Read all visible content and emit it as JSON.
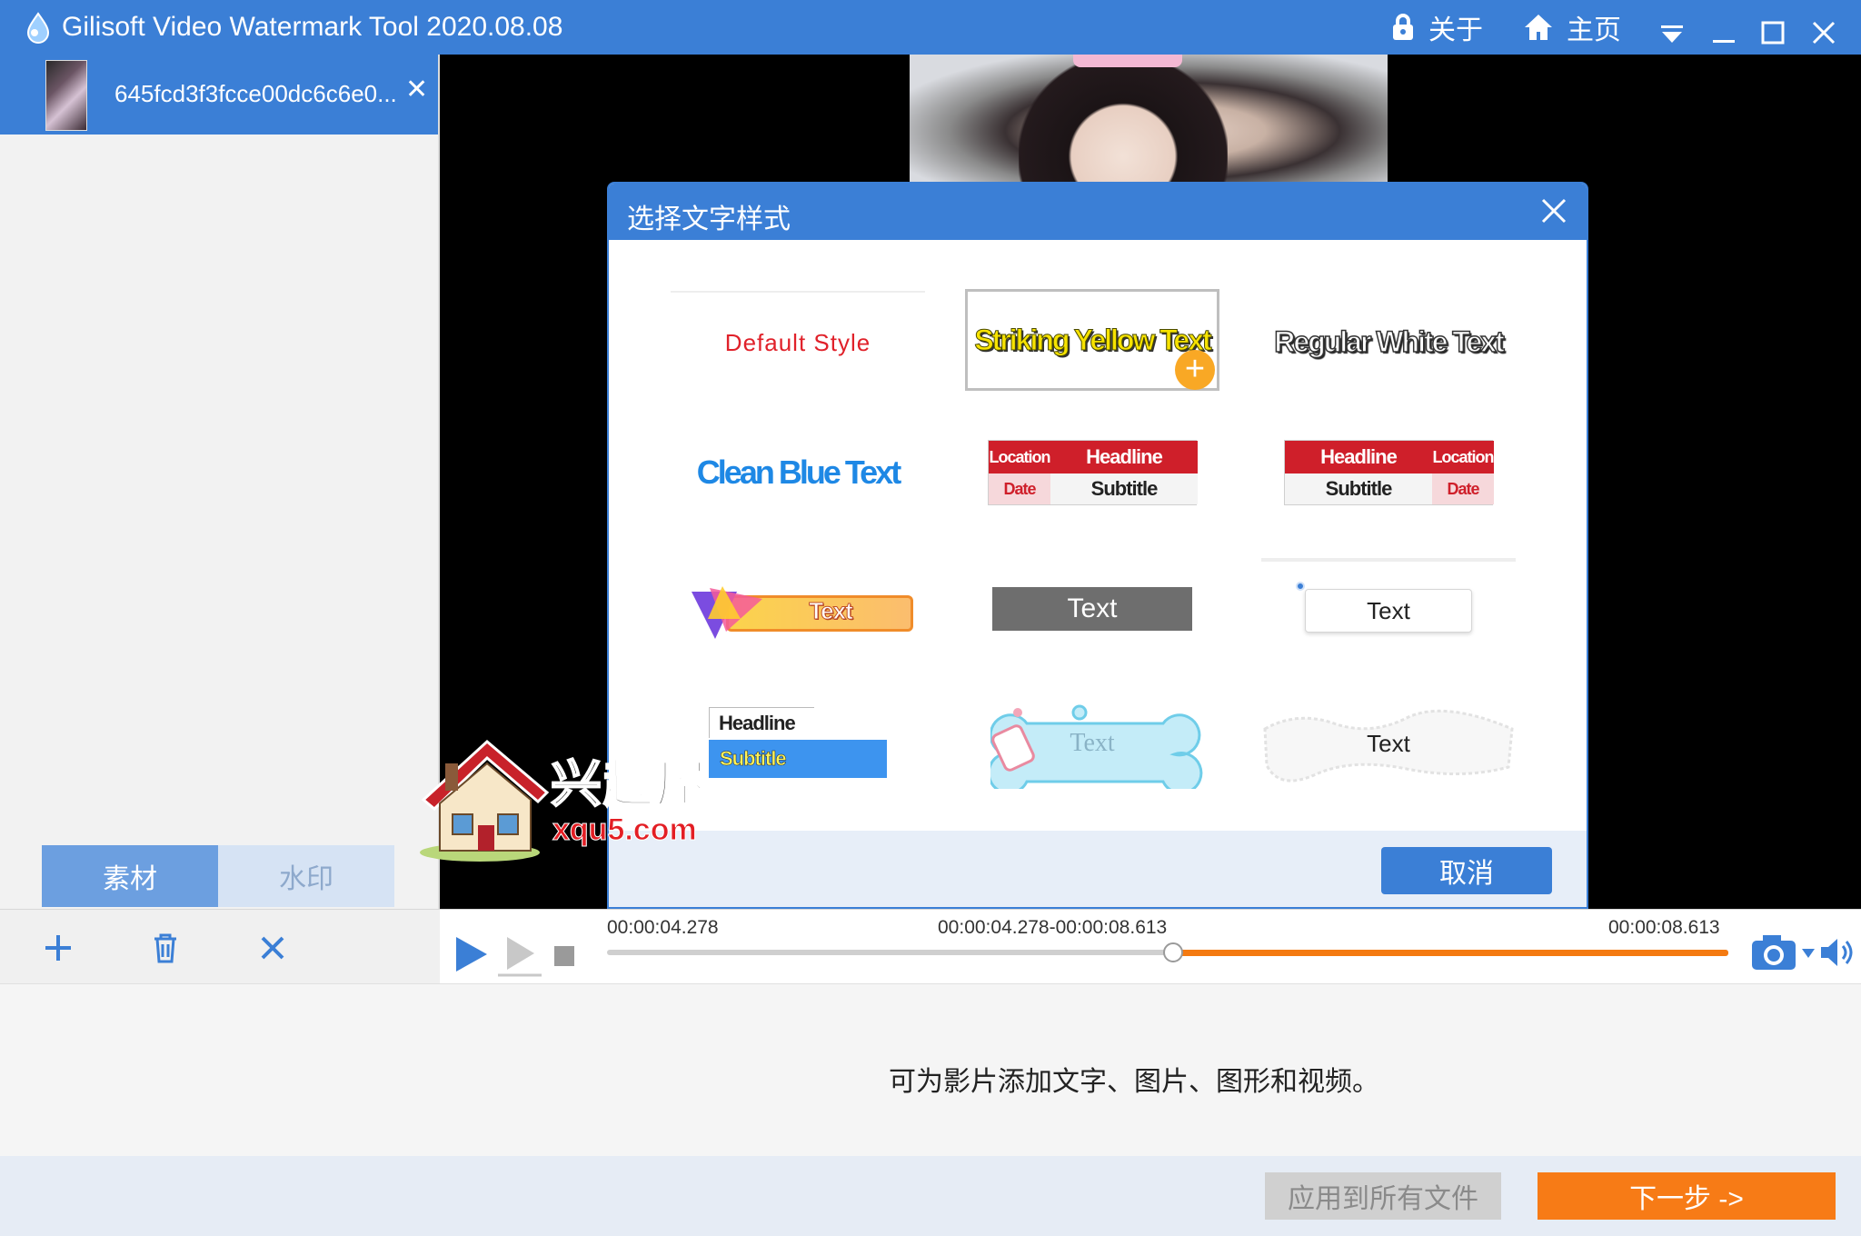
{
  "window": {
    "title": "Gilisoft Video Watermark Tool 2020.08.08",
    "about_label": "关于",
    "home_label": "主页"
  },
  "file": {
    "name": "645fcd3f3fcce00dc6c6e0..."
  },
  "left_tabs": {
    "materials": "素材",
    "watermark": "水印"
  },
  "dialog": {
    "title": "选择文字样式",
    "cancel_label": "取消",
    "styles": {
      "default": "Default Style",
      "striking_yellow": "Striking Yellow Text",
      "regular_white": "Regular White Text",
      "clean_blue": "Clean Blue Text",
      "lower_a": {
        "location": "Location",
        "headline": "Headline",
        "date": "Date",
        "subtitle": "Subtitle"
      },
      "lower_b": {
        "headline": "Headline",
        "location": "Location",
        "subtitle": "Subtitle",
        "date": "Date"
      },
      "gradient": "Text",
      "gray": "Text",
      "bubble": "Text",
      "headline_subtitle": {
        "headline": "Headline",
        "subtitle": "Subtitle"
      },
      "bone": "Text",
      "brush": "Text"
    }
  },
  "timeline": {
    "start_time": "00:00:04.278",
    "range_time": "00:00:04.278-00:00:08.613",
    "end_time": "00:00:08.613",
    "handle_position": 0.51
  },
  "info": {
    "message": "可为影片添加文字、图片、图形和视频。"
  },
  "footer": {
    "apply_all_label": "应用到所有文件",
    "next_label": "下一步 ->"
  },
  "watermark_logo": {
    "name": "兴趣屋",
    "url": "xqu5.com"
  },
  "colors": {
    "accent": "#3b7fd6",
    "next_button": "#f77b16",
    "track_fill": "#f47a11"
  }
}
